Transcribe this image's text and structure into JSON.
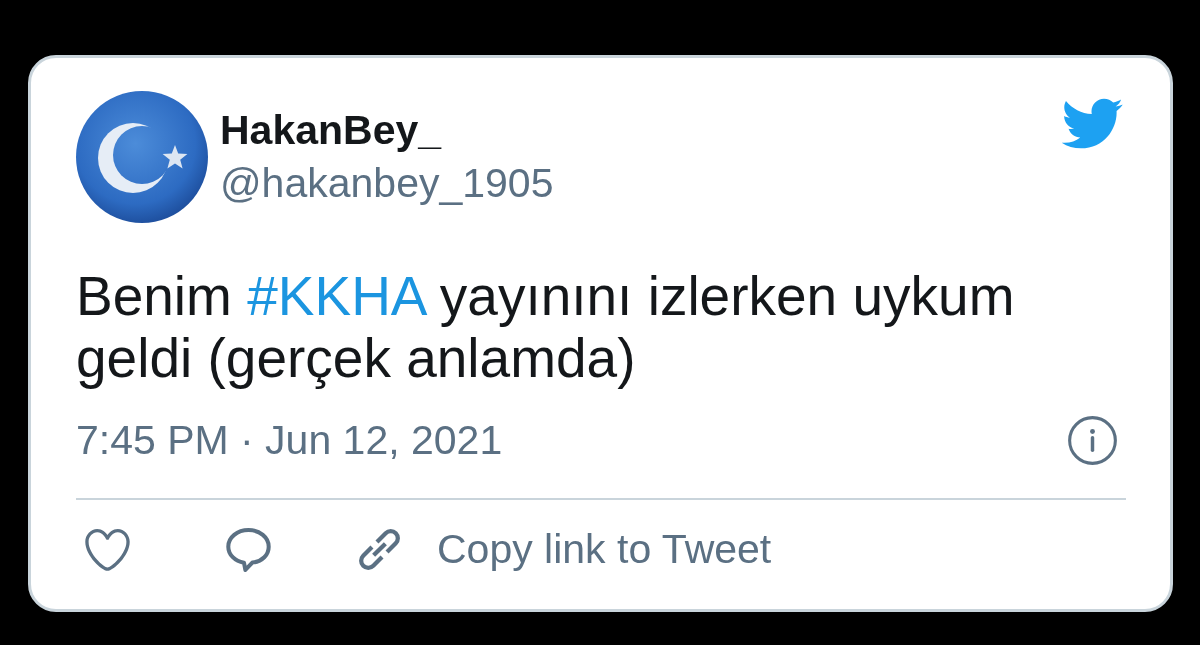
{
  "tweet": {
    "author": {
      "display_name": "HakanBey_",
      "handle": "@hakanbey_1905"
    },
    "text": [
      {
        "kind": "text",
        "text": "Benim "
      },
      {
        "kind": "hashtag",
        "text": "#KKHA"
      },
      {
        "kind": "text",
        "text": " yayınını izlerken uykum geldi (gerçek anlamda)"
      }
    ],
    "timestamp": "7:45 PM · Jun 12, 2021",
    "copy_link_label": "Copy link to Tweet"
  }
}
